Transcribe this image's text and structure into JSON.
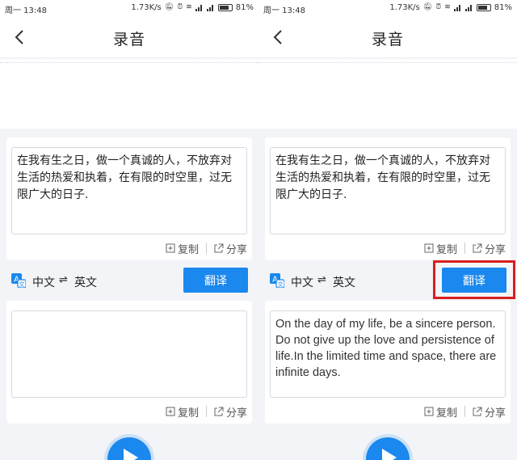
{
  "status_bar": {
    "time": "周一 13:48",
    "speed": "1.73K/s",
    "battery": "81%",
    "battery_level": 0.81
  },
  "nav": {
    "title": "录音"
  },
  "source": {
    "text": "在我有生之日，做一个真诚的人，不放弃对生活的热爱和执着，在有限的时空里，过无限广大的日子."
  },
  "actions": {
    "copy": "复制",
    "share": "分享"
  },
  "lang": {
    "from": "中文",
    "swap": "⇌",
    "to": "英文",
    "translate": "翻译"
  },
  "screens": {
    "left": {
      "result": ""
    },
    "right": {
      "result": "On the day of my life, be a sincere person. Do not give up the love and persistence of life.In the limited time and space, there are infinite days."
    }
  },
  "colors": {
    "accent": "#1a88ee",
    "highlight": "#d91e1e"
  }
}
